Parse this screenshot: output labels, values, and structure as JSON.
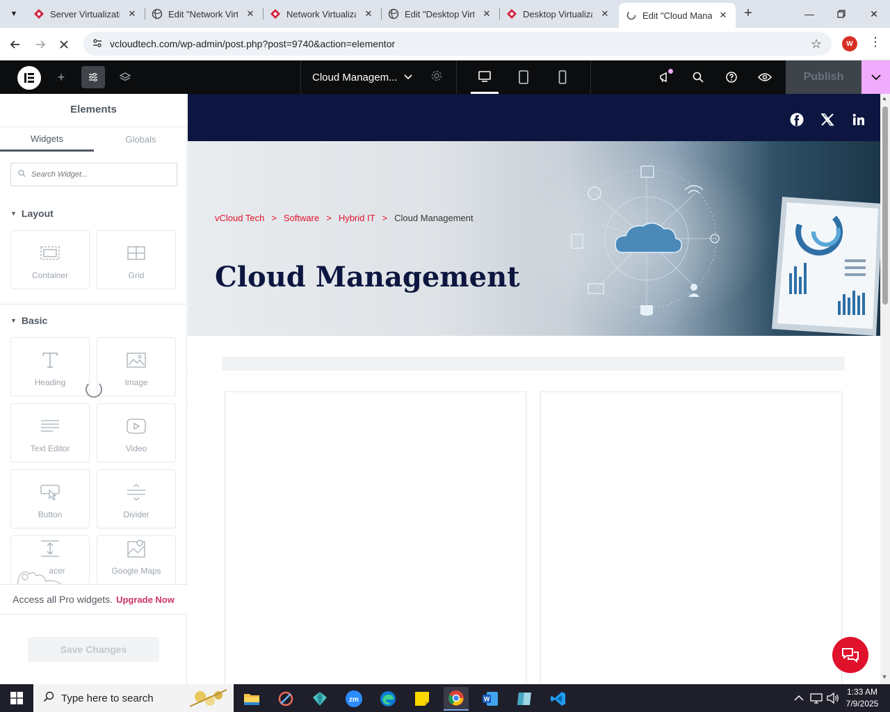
{
  "browser": {
    "tabs": [
      {
        "title": "Server Virtualizatio",
        "icon": "elementor-red-icon",
        "active": false
      },
      {
        "title": "Edit \"Network Virtu",
        "icon": "globe-icon",
        "active": false
      },
      {
        "title": "Network Virtualizat",
        "icon": "elementor-red-icon",
        "active": false
      },
      {
        "title": "Edit \"Desktop Virtu",
        "icon": "globe-icon",
        "active": false
      },
      {
        "title": "Desktop Virtualizat",
        "icon": "elementor-red-icon",
        "active": false
      },
      {
        "title": "Edit \"Cloud Manag",
        "icon": "loading-icon",
        "active": true
      }
    ],
    "url": "vcloudtech.com/wp-admin/post.php?post=9740&action=elementor",
    "profile_initial": "W"
  },
  "elementor": {
    "document_title": "Cloud Managem...",
    "publish_label": "Publish",
    "panel": {
      "title": "Elements",
      "tabs": [
        "Widgets",
        "Globals"
      ],
      "search_placeholder": "Search Widget...",
      "categories": {
        "layout": "Layout",
        "basic": "Basic"
      },
      "widgets": {
        "container": "Container",
        "grid": "Grid",
        "heading": "Heading",
        "image": "Image",
        "text_editor": "Text Editor",
        "video": "Video",
        "button": "Button",
        "divider": "Divider",
        "spacer": "acer",
        "google_maps": "Google Maps"
      },
      "upgrade_text": "Access all Pro widgets.",
      "upgrade_link": "Upgrade Now",
      "save_label": "Save Changes"
    }
  },
  "page": {
    "breadcrumb": [
      "vCloud Tech",
      "Software",
      "Hybrid IT",
      "Cloud Management"
    ],
    "breadcrumb_sep": ">",
    "hero_title": "Cloud Management"
  },
  "taskbar": {
    "search_placeholder": "Type here to search",
    "time": "1:33 AM",
    "date": "7/9/2025"
  },
  "colors": {
    "accent_red": "#e0112b",
    "navy": "#0c1640",
    "publish_pink": "#f0abfc"
  }
}
